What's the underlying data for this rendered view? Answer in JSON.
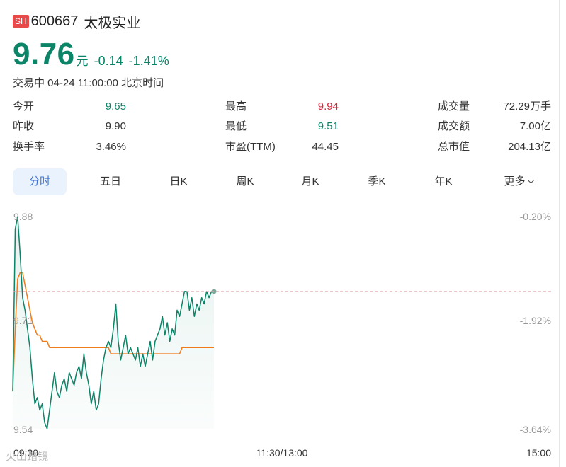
{
  "stock": {
    "exchange": "SH",
    "code": "600667",
    "name": "太极实业",
    "price": "9.76",
    "unit": "元",
    "change": "-0.14",
    "change_pct": "-1.41%",
    "status": "交易中 04-24 11:00:00 北京时间"
  },
  "stats": {
    "open": {
      "label": "今开",
      "value": "9.65"
    },
    "prev_close": {
      "label": "昨收",
      "value": "9.90"
    },
    "turnover_rate": {
      "label": "换手率",
      "value": "3.46%"
    },
    "high": {
      "label": "最高",
      "value": "9.94"
    },
    "low": {
      "label": "最低",
      "value": "9.51"
    },
    "pe": {
      "label": "市盈(TTM)",
      "value": "44.45"
    },
    "volume": {
      "label": "成交量",
      "value": "72.29万手"
    },
    "amount": {
      "label": "成交额",
      "value": "7.00亿"
    },
    "market_cap": {
      "label": "总市值",
      "value": "204.13亿"
    }
  },
  "tabs": [
    "分时",
    "五日",
    "日K",
    "周K",
    "月K",
    "季K",
    "年K",
    "更多"
  ],
  "active_tab": "分时",
  "chart": {
    "y_labels": [
      "9.88",
      "9.71",
      "9.54"
    ],
    "pct_labels": [
      "-0.20%",
      "-1.92%",
      "-3.64%"
    ],
    "time_labels": [
      "09:30",
      "11:30/13:00",
      "15:00"
    ],
    "watermark": "火山踏镜"
  },
  "colors": {
    "up": "#d9263b",
    "down": "#0b8468",
    "avg_line": "#ef7b1a",
    "active_tab_bg": "#e9f2fd",
    "active_tab_text": "#3b74d7"
  },
  "chart_data": {
    "type": "line",
    "x_label": "",
    "y_label": "",
    "x_range": [
      "09:30",
      "15:00"
    ],
    "ylim": [
      9.54,
      9.88
    ],
    "secondary_ylim": [
      "-3.64%",
      "-0.20%"
    ],
    "reference_line": {
      "name": "",
      "value": 9.76
    },
    "series": [
      {
        "name": "",
        "color": "#0b8468",
        "values": [
          9.6,
          9.86,
          9.88,
          9.82,
          9.75,
          9.73,
          9.7,
          9.67,
          9.62,
          9.58,
          9.59,
          9.57,
          9.58,
          9.55,
          9.54,
          9.57,
          9.6,
          9.63,
          9.6,
          9.59,
          9.61,
          9.62,
          9.6,
          9.63,
          9.62,
          9.61,
          9.63,
          9.64,
          9.62,
          9.66,
          9.63,
          9.61,
          9.58,
          9.6,
          9.57,
          9.58,
          9.62,
          9.65,
          9.67,
          9.68,
          9.67,
          9.7,
          9.74,
          9.68,
          9.65,
          9.67,
          9.69,
          9.66,
          9.67,
          9.66,
          9.65,
          9.67,
          9.64,
          9.66,
          9.64,
          9.66,
          9.68,
          9.65,
          9.68,
          9.69,
          9.7,
          9.72,
          9.69,
          9.71,
          9.68,
          9.7,
          9.69,
          9.73,
          9.72,
          9.74,
          9.76,
          9.76,
          9.73,
          9.75,
          9.72,
          9.74,
          9.73,
          9.75,
          9.74,
          9.76,
          9.75,
          9.76,
          9.76
        ]
      },
      {
        "name": "",
        "color": "#ef7b1a",
        "values": [
          9.6,
          9.7,
          9.78,
          9.79,
          9.79,
          9.77,
          9.75,
          9.73,
          9.71,
          9.7,
          9.69,
          9.69,
          9.68,
          9.68,
          9.68,
          9.67,
          9.67,
          9.67,
          9.67,
          9.67,
          9.67,
          9.67,
          9.67,
          9.67,
          9.67,
          9.67,
          9.67,
          9.67,
          9.67,
          9.67,
          9.67,
          9.67,
          9.67,
          9.67,
          9.67,
          9.67,
          9.67,
          9.67,
          9.67,
          9.67,
          9.66,
          9.66,
          9.66,
          9.66,
          9.66,
          9.66,
          9.66,
          9.66,
          9.66,
          9.66,
          9.66,
          9.66,
          9.66,
          9.66,
          9.66,
          9.66,
          9.66,
          9.66,
          9.66,
          9.66,
          9.66,
          9.66,
          9.66,
          9.66,
          9.66,
          9.66,
          9.66,
          9.66,
          9.66,
          9.67,
          9.67,
          9.67,
          9.67,
          9.67,
          9.67,
          9.67,
          9.67,
          9.67,
          9.67,
          9.67,
          9.67,
          9.67,
          9.67
        ]
      }
    ]
  }
}
